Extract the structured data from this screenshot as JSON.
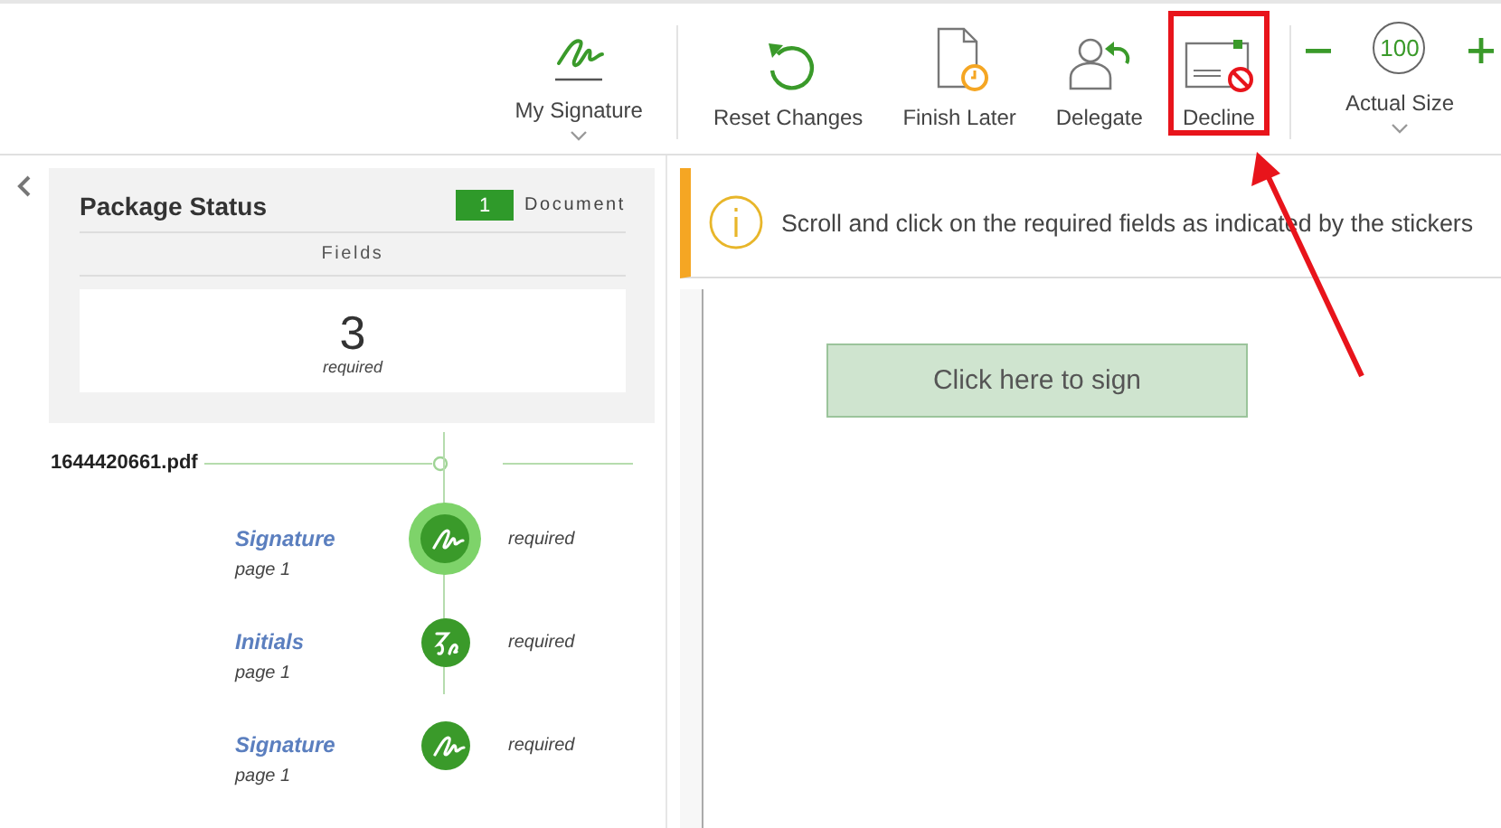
{
  "toolbar": {
    "items": [
      {
        "kind": "signature",
        "label": "My Signature",
        "dropdown": true,
        "highlighted": false
      },
      {
        "kind": "separator"
      },
      {
        "kind": "reset",
        "label": "Reset Changes",
        "dropdown": false,
        "highlighted": false
      },
      {
        "kind": "finish-later",
        "label": "Finish Later",
        "dropdown": false,
        "highlighted": false
      },
      {
        "kind": "delegate",
        "label": "Delegate",
        "dropdown": false,
        "highlighted": false
      },
      {
        "kind": "decline",
        "label": "Decline",
        "dropdown": false,
        "highlighted": true
      },
      {
        "kind": "separator"
      }
    ],
    "zoom": {
      "value": "100",
      "label": "Actual Size",
      "dropdown": true
    }
  },
  "package_status": {
    "title": "Package Status",
    "document_count": "1",
    "document_label": "Document",
    "fields_label": "Fields",
    "required_count": "3",
    "required_label": "required"
  },
  "document": {
    "file_name": "1644420661.pdf",
    "fields": [
      {
        "kind": "signature",
        "name": "Signature",
        "page": "page 1",
        "status": "required",
        "selected": true
      },
      {
        "kind": "initials",
        "name": "Initials",
        "page": "page 1",
        "status": "required",
        "selected": false
      },
      {
        "kind": "signature",
        "name": "Signature",
        "page": "page 1",
        "status": "required",
        "selected": false
      }
    ]
  },
  "notice": {
    "text": "Scroll and click on the required fields as indicated by the stickers"
  },
  "sign_button": {
    "label": "Click here to sign"
  }
}
